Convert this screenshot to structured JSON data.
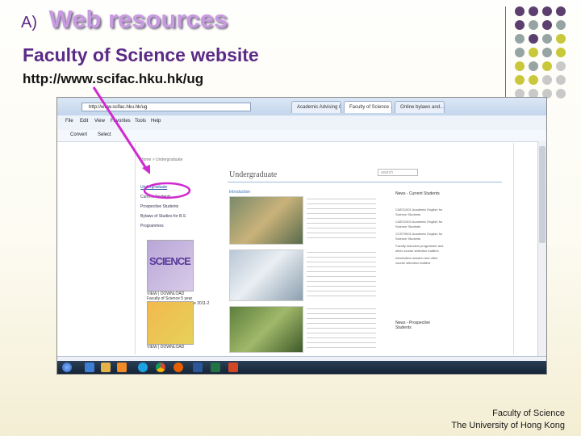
{
  "slide": {
    "title_prefix": "A)",
    "title": "Web resources",
    "subtitle": "Faculty of Science website",
    "url": "http://www.scifac.hku.hk/ug",
    "footer_line1": "Faculty of Science",
    "footer_line2": "The University of Hong Kong"
  },
  "colors": {
    "title_purple": "#5b2a86",
    "title_lavender": "#c89be0",
    "arrow": "#d02bd0",
    "dot_purple": "#5c3f6e",
    "dot_teal": "#96a5a3",
    "dot_yellow": "#c9c83a",
    "dot_gray": "#c9c9c9"
  },
  "browser": {
    "address": "http://www.scifac.hku.hk/ug",
    "tabs": [
      "Academic Advising G...",
      "Faculty of Science ...",
      "Online bylaws and..."
    ],
    "menu": [
      "File",
      "Edit",
      "View",
      "Favorites",
      "Tools",
      "Help"
    ],
    "toolbar": [
      "Convert",
      "Select"
    ],
    "icons": [
      "ie-icon",
      "folder-icon",
      "media-icon",
      "skype-icon",
      "chrome-icon",
      "firefox-icon",
      "word-icon",
      "excel-icon",
      "powerpoint-icon"
    ],
    "page": {
      "breadcrumb": "Home > Undergraduate",
      "heading": "Undergraduate",
      "search_placeholder": "search",
      "intro_label": "Introduction",
      "side_links": [
        "Undergraduate",
        "Current Students",
        "Prospective Students",
        "Bylaws of Studies for B.S",
        "Programmes"
      ],
      "brochure1_word": "SCIENCE",
      "brochure_caption": "VIEW | DOWNLOAD",
      "brochure1_desc": "Faculty of Science 5 year Undergraduate Programme 2011-2",
      "brochure2_desc": "",
      "news_current": "News - Current Students",
      "news_prospective": "News - Prospective Students",
      "news_items": [
        "CAES1001 Academic English for Science Students",
        "CAES1002 Academic English for Science Students",
        "CCST9001 Academic English for Science Students",
        "Faculty induction programme and other course selection matters",
        "Information session and other course selection matters"
      ]
    }
  }
}
